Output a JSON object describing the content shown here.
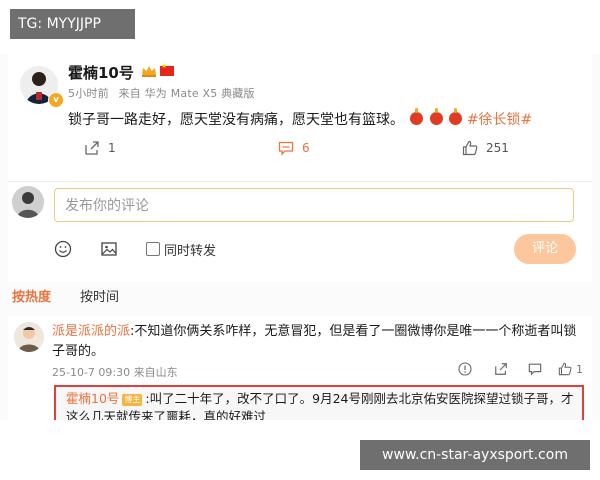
{
  "watermarks": {
    "top_left": "TG: MYYJJPP",
    "bottom_right": "www.cn-star-ayxsport.com"
  },
  "post": {
    "author": "霍楠10号",
    "time": "5小时前",
    "source": "来自 华为 Mate X5 典藏版",
    "body": "锁子哥一路走好，愿天堂没有病痛，愿天堂也有篮球。",
    "hashtag": "#徐长锁#",
    "actions": {
      "reposts": "1",
      "comments": "6",
      "likes": "251"
    },
    "colors": {
      "accent": "#eb7340"
    }
  },
  "composer": {
    "placeholder": "发布你的评论",
    "repost_label": "同时转发",
    "submit_label": "评论"
  },
  "sort_tabs": {
    "hot": "按热度",
    "time": "按时间"
  },
  "comment": {
    "name": "派是派派的派",
    "text": ":不知道你俩关系咋样，无意冒犯，但是看了一圈微博你是唯一一个称逝者叫锁子哥的。",
    "time": "25-10-7 09:30 来自山东",
    "likes": "1",
    "reply": {
      "name": "霍楠10号",
      "badge": "博主",
      "text": ":叫了二十年了，改不了口了。9月24号刚刚去北京佑安医院探望过锁子哥，才这么几天就传来了噩耗，真的好难过"
    }
  }
}
